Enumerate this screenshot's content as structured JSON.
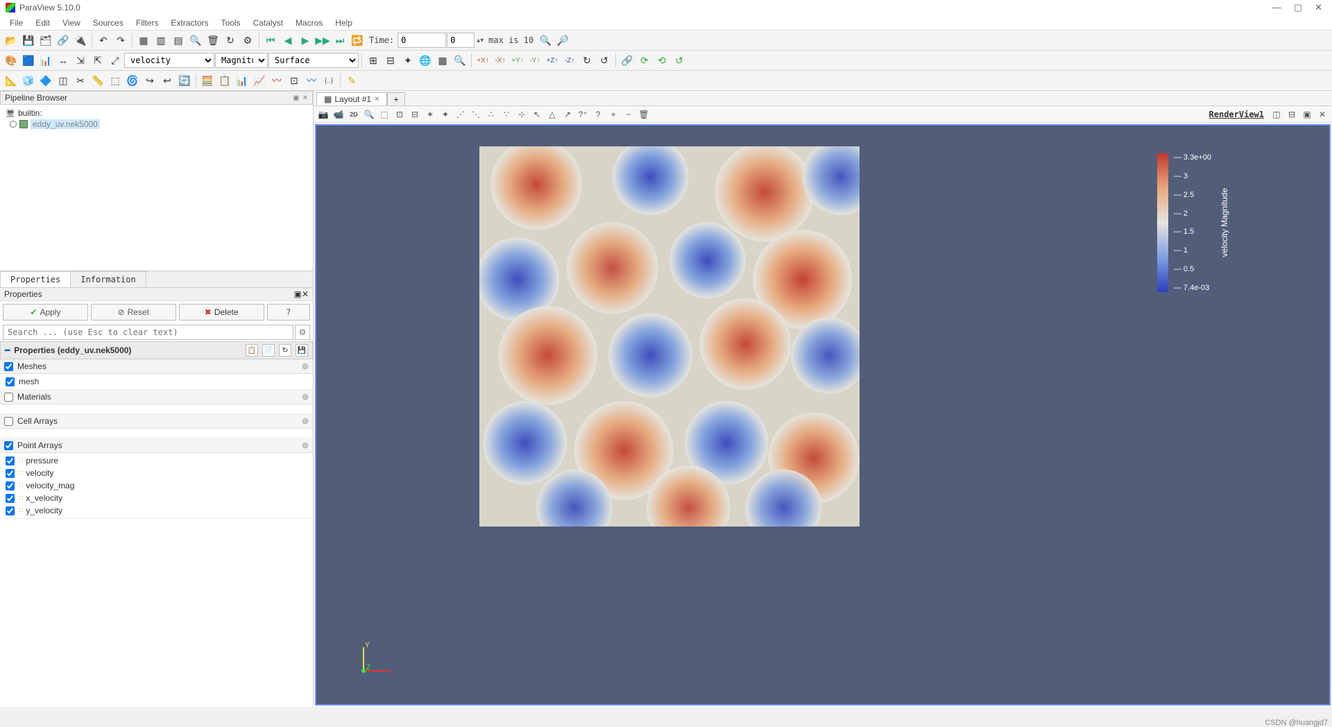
{
  "app": {
    "title": "ParaView 5.10.0"
  },
  "window_controls": {
    "min": "—",
    "max": "▢",
    "close": "✕"
  },
  "menu": {
    "file": "File",
    "edit": "Edit",
    "view": "View",
    "sources": "Sources",
    "filters": "Filters",
    "extractors": "Extractors",
    "tools": "Tools",
    "catalyst": "Catalyst",
    "macros": "Macros",
    "help": "Help"
  },
  "time": {
    "label": "Time:",
    "value": "0",
    "step": "0",
    "max_text": "max is 10"
  },
  "combo": {
    "array": "velocity",
    "component": "Magnitud",
    "repr": "Surface"
  },
  "pipeline": {
    "title": "Pipeline Browser",
    "server": "builtin:",
    "source": "eddy_uv.nek5000"
  },
  "tabs": {
    "properties": "Properties",
    "information": "Information"
  },
  "props": {
    "title": "Properties",
    "apply": "Apply",
    "reset": "Reset",
    "delete": "Delete",
    "help": "?",
    "search_placeholder": "Search ... (use Esc to clear text)",
    "section": "Properties (eddy_uv.nek5000)",
    "groups": {
      "meshes": {
        "label": "Meshes",
        "items": [
          {
            "name": "mesh",
            "checked": true
          }
        ]
      },
      "materials": {
        "label": "Materials",
        "items": []
      },
      "cell": {
        "label": "Cell Arrays",
        "items": []
      },
      "point": {
        "label": "Point Arrays",
        "items": [
          {
            "name": "pressure",
            "checked": true
          },
          {
            "name": "velocity",
            "checked": true
          },
          {
            "name": "velocity_mag",
            "checked": true
          },
          {
            "name": "x_velocity",
            "checked": true
          },
          {
            "name": "y_velocity",
            "checked": true
          }
        ]
      }
    }
  },
  "layout": {
    "tab": "Layout #1",
    "viewname": "RenderView1"
  },
  "legend": {
    "title": "velocity Magnitude",
    "ticks": [
      "3.3e+00",
      "3",
      "2.5",
      "2",
      "1.5",
      "1",
      "0.5",
      "7.4e-03"
    ]
  },
  "axes": {
    "x": "X",
    "y": "Y",
    "z": "Z"
  },
  "watermark": "CSDN @huangjd7"
}
